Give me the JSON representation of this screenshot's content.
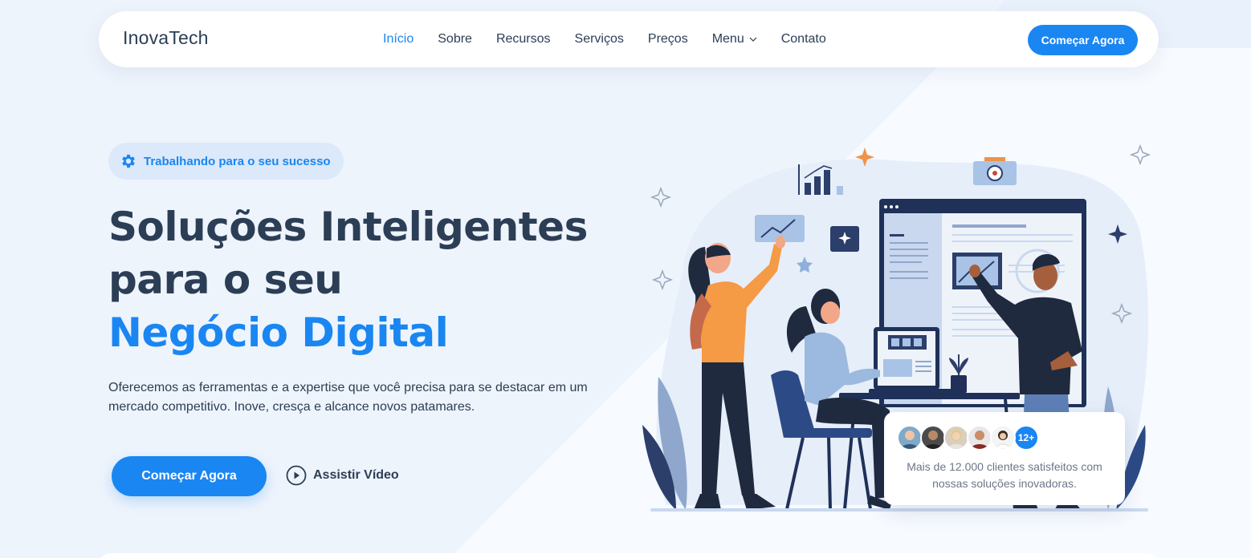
{
  "colors": {
    "accent": "#1a86f2",
    "heading": "#2c3e55",
    "badge_bg": "#dbe9fb",
    "page_bg": "#eef4fc"
  },
  "nav": {
    "logo": "InovaTech",
    "links": [
      {
        "label": "Início",
        "active": true
      },
      {
        "label": "Sobre",
        "active": false
      },
      {
        "label": "Recursos",
        "active": false
      },
      {
        "label": "Serviços",
        "active": false
      },
      {
        "label": "Preços",
        "active": false
      },
      {
        "label": "Menu",
        "active": false,
        "icon": "chevron-down-icon"
      },
      {
        "label": "Contato",
        "active": false
      }
    ],
    "cta": "Começar Agora"
  },
  "hero": {
    "badge": {
      "icon": "gear-icon",
      "text": "Trabalhando para o seu sucesso"
    },
    "title_line1": "Soluções Inteligentes",
    "title_line2": "para o seu",
    "title_accent": "Negócio Digital",
    "description": "Oferecemos as ferramentas e a expertise que você precisa para se destacar em um mercado competitivo. Inove, cresça e alcance novos patamares.",
    "cta": "Começar Agora",
    "video": {
      "icon": "play-circle-icon",
      "label": "Assistir Vídeo"
    }
  },
  "clients": {
    "count_badge": "12+",
    "text": "Mais de 12.000 clientes satisfeitos com nossas soluções inovadoras."
  }
}
